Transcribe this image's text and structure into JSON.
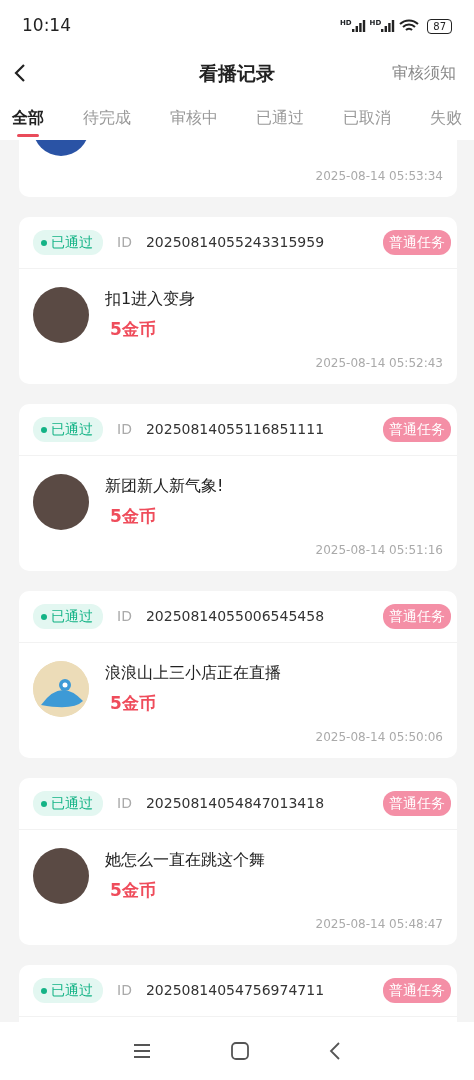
{
  "status_bar": {
    "time": "10:14",
    "signal_labels": [
      "HD",
      "HD"
    ],
    "battery": "87"
  },
  "header": {
    "title": "看播记录",
    "action": "审核须知"
  },
  "tabs": [
    {
      "label": "全部",
      "selected": true
    },
    {
      "label": "待完成",
      "selected": false
    },
    {
      "label": "审核中",
      "selected": false
    },
    {
      "label": "已通过",
      "selected": false
    },
    {
      "label": "已取消",
      "selected": false
    },
    {
      "label": "失败",
      "selected": false
    }
  ],
  "records": [
    {
      "kind": "cut_top",
      "avatar": {
        "kind": "blue"
      },
      "time": "2025-08-14 05:53:34"
    },
    {
      "kind": "full",
      "status": "已通过",
      "id_label": "ID",
      "id": "20250814055243315959",
      "tag": "普通任务",
      "avatar": {
        "kind": "photo"
      },
      "title": "扣1进入变身",
      "reward": "5金币",
      "time": "2025-08-14 05:52:43"
    },
    {
      "kind": "full",
      "status": "已通过",
      "id_label": "ID",
      "id": "20250814055116851111",
      "tag": "普通任务",
      "avatar": {
        "kind": "photo"
      },
      "title": "新团新人新气象!",
      "reward": "5金币",
      "time": "2025-08-14 05:51:16"
    },
    {
      "kind": "full",
      "status": "已通过",
      "id_label": "ID",
      "id": "20250814055006545458",
      "tag": "普通任务",
      "avatar": {
        "kind": "cartoon"
      },
      "title": "浪浪山上三小店正在直播",
      "reward": "5金币",
      "time": "2025-08-14 05:50:06"
    },
    {
      "kind": "full",
      "status": "已通过",
      "id_label": "ID",
      "id": "20250814054847013418",
      "tag": "普通任务",
      "avatar": {
        "kind": "photo"
      },
      "title": "她怎么一直在跳这个舞",
      "reward": "5金币",
      "time": "2025-08-14 05:48:47"
    },
    {
      "kind": "cut_bottom",
      "status": "已通过",
      "id_label": "ID",
      "id": "20250814054756974711",
      "tag": "普通任务"
    }
  ]
}
